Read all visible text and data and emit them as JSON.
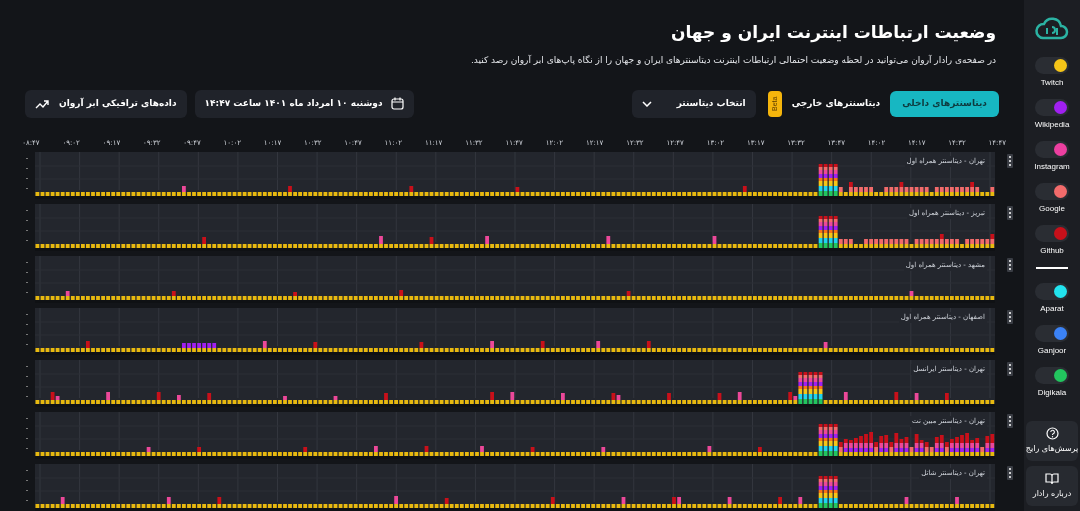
{
  "header": {
    "title": "وضعیت ارتباطات اینترنت ایران و جهان",
    "subtitle": "در صفحه‌ی رادار آروان می‌توانید در لحظه وضعیت احتمالی ارتباطات اینترنت دیتاسنترهای ایران و جهان را از نگاه پاپ‌های ابر آروان رصد کنید."
  },
  "controls": {
    "tabs": [
      {
        "label": "دیتاسنترهای داخلی",
        "selected": true
      },
      {
        "label": "دیتاسنترهای خارجی",
        "selected": false,
        "badge": "Beta"
      }
    ],
    "datacenter_select": {
      "value": "انتخاب دیتاسنتر"
    },
    "date_picker": {
      "value": "دوشنبه ۱۰ امرداد ماه ۱۴۰۱ ساعت ۱۴:۴۷"
    },
    "traffic_button": {
      "label": "داده‌های ترافیکی ابر آروان"
    }
  },
  "time_axis": [
    "۱۴:۴۷",
    "۱۴:۳۲",
    "۱۴:۱۷",
    "۱۴:۰۲",
    "۱۳:۴۷",
    "۱۳:۳۲",
    "۱۳:۱۷",
    "۱۳:۰۲",
    "۱۲:۴۷",
    "۱۲:۳۲",
    "۱۲:۱۷",
    "۱۲:۰۲",
    "۱۱:۴۷",
    "۱۱:۳۲",
    "۱۱:۱۷",
    "۱۱:۰۲",
    "۱۰:۴۷",
    "۱۰:۳۲",
    "۱۰:۱۷",
    "۱۰:۰۲",
    "۰۹:۴۷",
    "۰۹:۳۲",
    "۰۹:۱۷",
    "۰۹:۰۲",
    "۰۸:۴۷"
  ],
  "charts": [
    {
      "label": "تهران - دیتاسنتر همراه اول"
    },
    {
      "label": "تبریز - دیتاسنتر همراه اول"
    },
    {
      "label": "مشهد - دیتاسنتر همراه اول"
    },
    {
      "label": "اصفهان - دیتاسنتر همراه اول"
    },
    {
      "label": "تهران - دیتاسنتر ایرانسل"
    },
    {
      "label": "تهران - دیتاسنتر مبین نت"
    },
    {
      "label": "تهران - دیتاسنتر شاتل"
    }
  ],
  "sidebar": {
    "external_services": [
      {
        "name": "Twitch",
        "color": "#f5c518",
        "on": true
      },
      {
        "name": "Wikipedia",
        "color": "#a020f0",
        "on": true
      },
      {
        "name": "Instagram",
        "color": "#ec3fa0",
        "on": true
      },
      {
        "name": "Google",
        "color": "#f26b6b",
        "on": true
      },
      {
        "name": "Github",
        "color": "#c8101a",
        "on": true
      }
    ],
    "internal_services": [
      {
        "name": "Aparat",
        "color": "#22e3ee",
        "on": true
      },
      {
        "name": "Ganjoor",
        "color": "#3b82f6",
        "on": true
      },
      {
        "name": "Digikala",
        "color": "#22c55e",
        "on": true
      }
    ],
    "buttons": [
      {
        "kind": "faq",
        "label": "پرسش‌های رایج"
      },
      {
        "kind": "about",
        "label": "درباره رادار"
      }
    ]
  }
}
